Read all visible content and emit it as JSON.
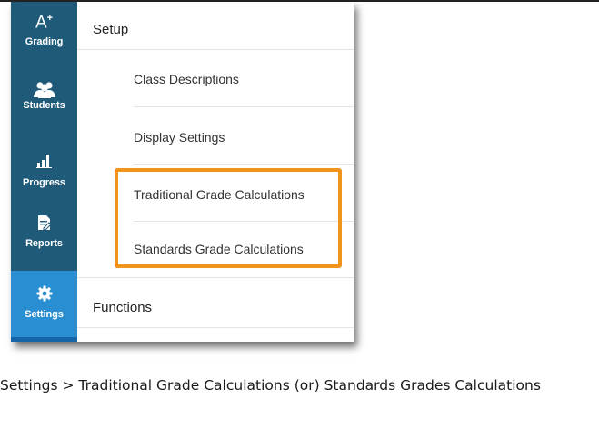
{
  "sidebar": {
    "items": [
      {
        "label": "Grading",
        "icon": "a-plus-icon",
        "active": false
      },
      {
        "label": "Students",
        "icon": "students-icon",
        "active": false
      },
      {
        "label": "Progress",
        "icon": "bar-chart-icon",
        "active": false
      },
      {
        "label": "Reports",
        "icon": "report-edit-icon",
        "active": false
      },
      {
        "label": "Settings",
        "icon": "gear-icon",
        "active": true
      }
    ],
    "grading_icon_text": "A+",
    "colors": {
      "background": "#1f5b79",
      "active": "#2a8fd2"
    }
  },
  "main": {
    "setup_title": "Setup",
    "setup_items": [
      "Class Descriptions",
      "Display Settings",
      "Traditional Grade Calculations",
      "Standards Grade Calculations"
    ],
    "functions_title": "Functions"
  },
  "highlight": {
    "color": "#f0941c"
  },
  "caption": "Settings > Traditional Grade Calculations (or) Standards Grades Calculations"
}
